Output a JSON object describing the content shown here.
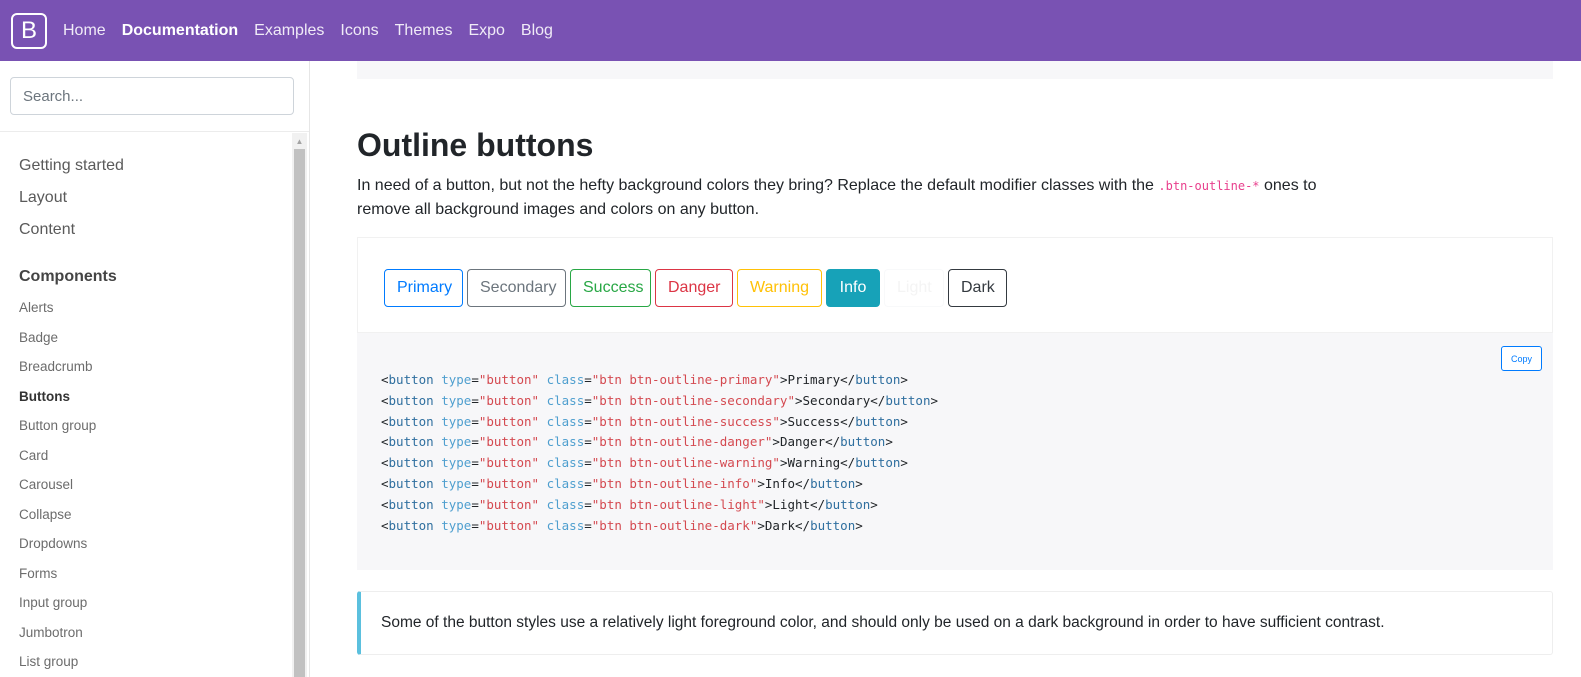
{
  "navbar": {
    "brand": "B",
    "links": [
      "Home",
      "Documentation",
      "Examples",
      "Icons",
      "Themes",
      "Expo",
      "Blog"
    ]
  },
  "sidebar": {
    "search_placeholder": "Search...",
    "groups": [
      "Getting started",
      "Layout",
      "Content",
      "Components"
    ],
    "items": [
      "Alerts",
      "Badge",
      "Breadcrumb",
      "Buttons",
      "Button group",
      "Card",
      "Carousel",
      "Collapse",
      "Dropdowns",
      "Forms",
      "Input group",
      "Jumbotron",
      "List group"
    ]
  },
  "main": {
    "title": "Outline buttons",
    "lead_before": "In need of a button, but not the hefty background colors they bring? Replace the default modifier classes with the ",
    "lead_code": ".btn-outline-*",
    "lead_after": " ones to remove all background images and colors on any button.",
    "buttons": [
      "Primary",
      "Secondary",
      "Success",
      "Danger",
      "Warning",
      "Info",
      "Light",
      "Dark"
    ],
    "copy_label": "Copy",
    "code": {
      "tag": "button",
      "attr_type": "type",
      "attr_class": "class",
      "type_value": "\"button\"",
      "class_values": [
        "\"btn btn-outline-primary\"",
        "\"btn btn-outline-secondary\"",
        "\"btn btn-outline-success\"",
        "\"btn btn-outline-danger\"",
        "\"btn btn-outline-warning\"",
        "\"btn btn-outline-info\"",
        "\"btn btn-outline-light\"",
        "\"btn btn-outline-dark\""
      ],
      "texts": [
        "Primary",
        "Secondary",
        "Success",
        "Danger",
        "Warning",
        "Info",
        "Light",
        "Dark"
      ]
    },
    "callout": "Some of the button styles use a relatively light foreground color, and should only be used on a dark background in order to have sufficient contrast."
  },
  "colors": {
    "navbar": "#7952b3",
    "primary": "#007bff",
    "secondary": "#6c757d",
    "success": "#28a745",
    "danger": "#dc3545",
    "warning": "#ffc107",
    "info": "#17a2b8",
    "dark": "#343a40",
    "callout_border": "#5bc0de"
  }
}
